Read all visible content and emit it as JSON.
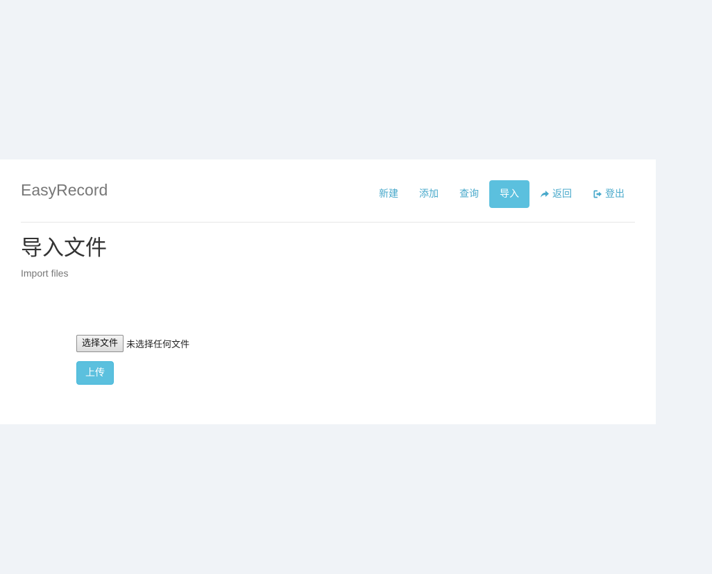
{
  "app": {
    "brand": "EasyRecord"
  },
  "nav": {
    "items": [
      {
        "label": "新建",
        "icon": null,
        "active": false
      },
      {
        "label": "添加",
        "icon": null,
        "active": false
      },
      {
        "label": "查询",
        "icon": null,
        "active": false
      },
      {
        "label": "导入",
        "icon": null,
        "active": true
      },
      {
        "label": "返回",
        "icon": "share-arrow-icon",
        "active": false
      },
      {
        "label": "登出",
        "icon": "logout-icon",
        "active": false
      }
    ]
  },
  "page": {
    "title": "导入文件",
    "subtitle": "Import files"
  },
  "upload_form": {
    "choose_file_label": "选择文件",
    "file_status": "未选择任何文件",
    "submit_label": "上传"
  },
  "colors": {
    "background": "#f0f3f7",
    "panel": "#ffffff",
    "accent": "#5bc0de",
    "link": "#49a9cb"
  }
}
